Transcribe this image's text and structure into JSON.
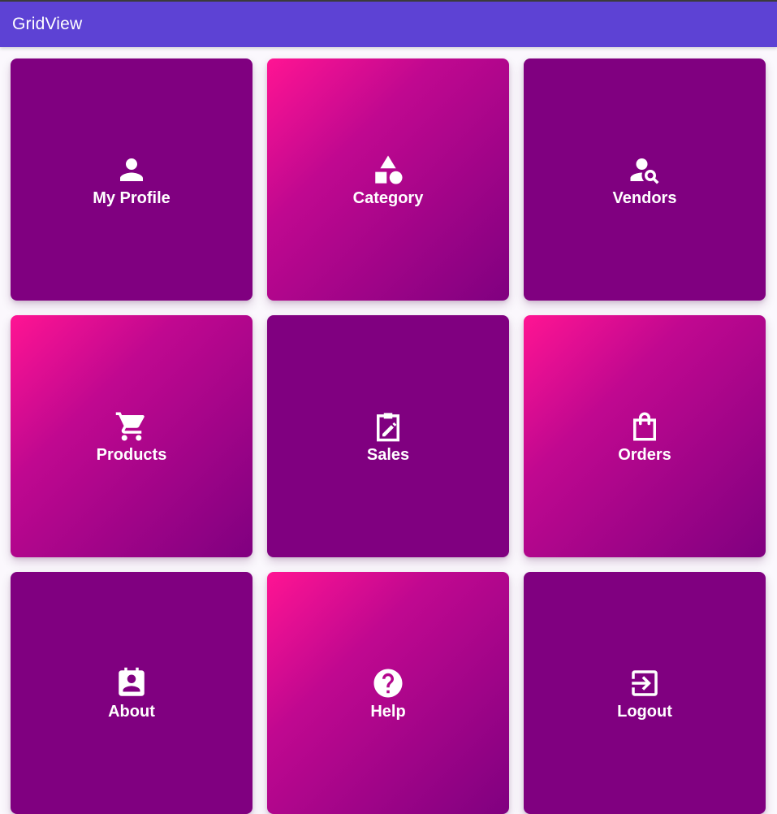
{
  "app_bar": {
    "title": "GridView",
    "color": "#5d42d4"
  },
  "colors": {
    "tile_solid": "#800080",
    "tile_gradient_start": "#ff1493",
    "tile_gradient_end": "#800080",
    "tile_text": "#ffffff"
  },
  "tiles": [
    {
      "label": "My Profile",
      "icon": "person-icon",
      "style": "solid"
    },
    {
      "label": "Category",
      "icon": "category-shapes-icon",
      "style": "gradient"
    },
    {
      "label": "Vendors",
      "icon": "person-search-icon",
      "style": "solid"
    },
    {
      "label": "Products",
      "icon": "shopping-cart-icon",
      "style": "gradient"
    },
    {
      "label": "Sales",
      "icon": "clipboard-edit-icon",
      "style": "solid"
    },
    {
      "label": "Orders",
      "icon": "shopping-bag-icon",
      "style": "gradient"
    },
    {
      "label": "About",
      "icon": "contact-card-icon",
      "style": "solid"
    },
    {
      "label": "Help",
      "icon": "help-circle-icon",
      "style": "gradient"
    },
    {
      "label": "Logout",
      "icon": "exit-icon",
      "style": "solid"
    }
  ]
}
